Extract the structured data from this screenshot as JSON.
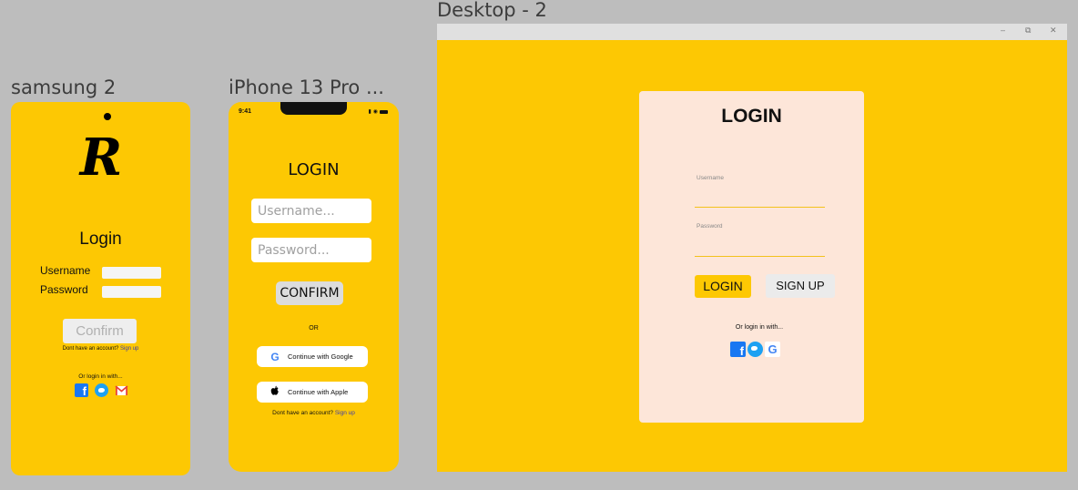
{
  "frames": {
    "samsung_label": "samsung 2",
    "iphone_label": "iPhone 13 Pro ...",
    "desktop_label": "Desktop - 2"
  },
  "samsung": {
    "logo_letter": "R",
    "title": "Login",
    "username_label": "Username",
    "password_label": "Password",
    "confirm_label": "Confirm",
    "no_account_text": "Dont have an account?",
    "signup_link": "Sign up",
    "or_login_text": "Or login in with...",
    "social_icons": [
      "facebook-icon",
      "twitter-icon",
      "gmail-icon"
    ]
  },
  "iphone": {
    "time": "9:41",
    "title": "LOGIN",
    "username_placeholder": "Username...",
    "password_placeholder": "Password...",
    "confirm_label": "CONFIRM",
    "or_text": "OR",
    "google_label": "Continue with Google",
    "apple_label": "Continue with Apple",
    "no_account_text": "Dont have an account?",
    "signup_link": "Sign up"
  },
  "desktop": {
    "window_controls": [
      "–",
      "⧉",
      "✕"
    ],
    "title": "LOGIN",
    "username_label": "Username",
    "password_label": "Password",
    "login_label": "LOGIN",
    "signup_label": "SIGN UP",
    "or_login_text": "Or login in with...",
    "social_icons": [
      "facebook-icon",
      "twitter-icon",
      "google-icon"
    ]
  },
  "colors": {
    "accent": "#fdc803",
    "canvas": "#bdbdbd",
    "card": "#fde6d9",
    "link": "#3b3bb0"
  }
}
